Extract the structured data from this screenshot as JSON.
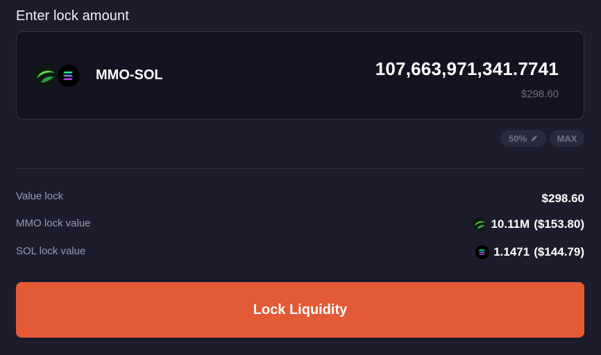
{
  "header": {
    "title": "Enter lock amount"
  },
  "input": {
    "pair_name": "MMO-SOL",
    "amount": "107,663,971,341.7741",
    "amount_usd": "$298.60",
    "icons": [
      "mmo-token-icon",
      "sol-token-icon"
    ]
  },
  "quick_select": {
    "half_label": "50%",
    "max_label": "MAX"
  },
  "summary": {
    "value_lock": {
      "label": "Value lock",
      "value": "$298.60"
    },
    "mmo_lock": {
      "label": "MMO lock value",
      "amount": "10.11M",
      "usd": "($153.80)"
    },
    "sol_lock": {
      "label": "SOL lock value",
      "amount": "1.1471",
      "usd": "($144.79)"
    }
  },
  "action": {
    "label": "Lock Liquidity"
  },
  "colors": {
    "background": "#1c1c2d",
    "card": "#131322",
    "accent": "#e45a36",
    "mmo_green": "#3dbb3d"
  }
}
